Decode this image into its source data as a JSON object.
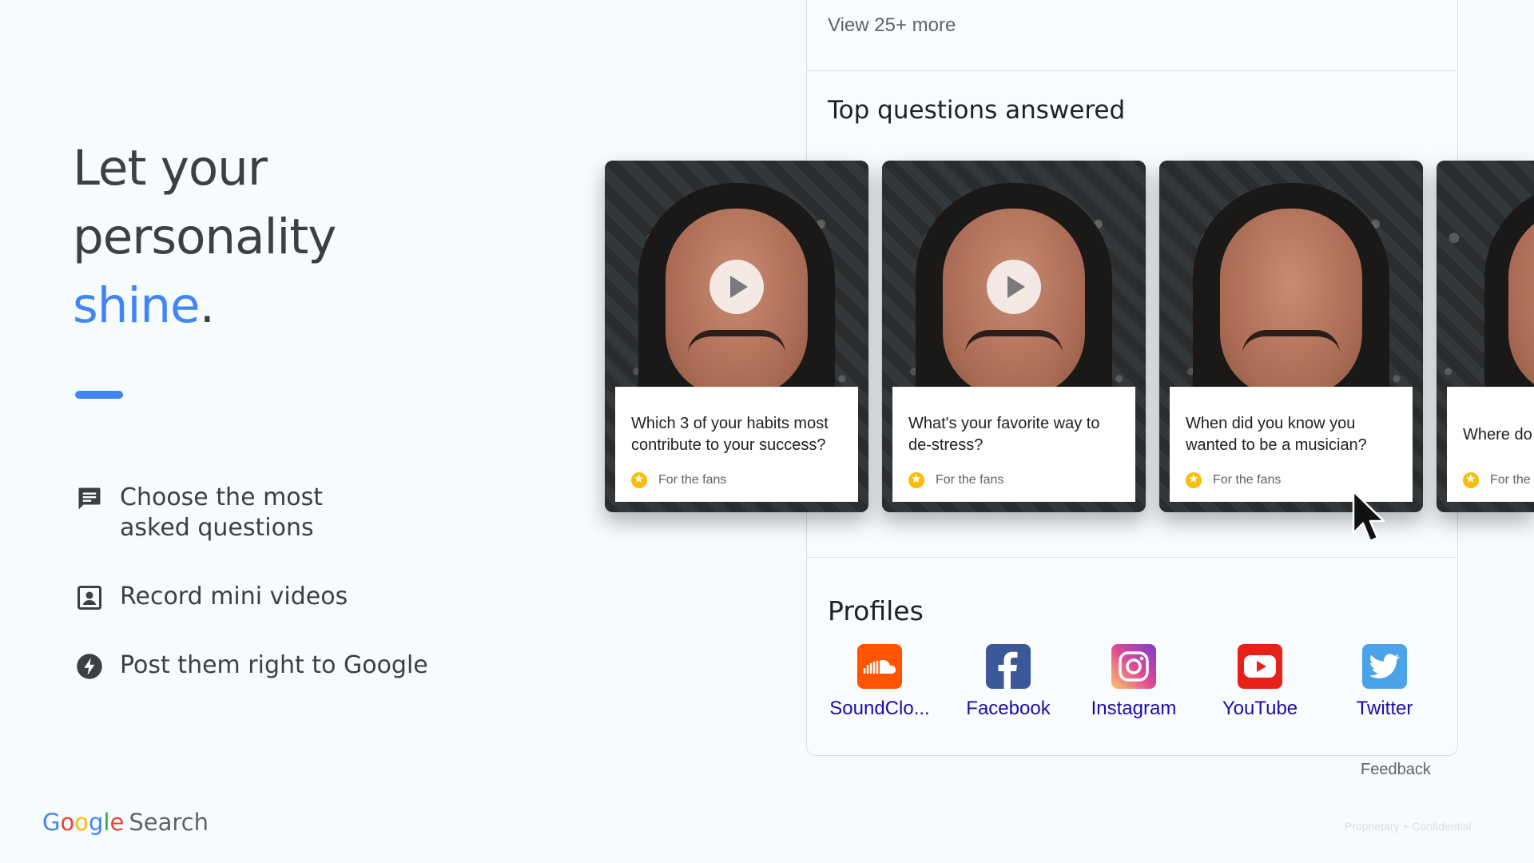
{
  "slide": {
    "headline_lines": [
      "Let your",
      "personality"
    ],
    "headline_accent": "shine",
    "headline_period": ".",
    "features": [
      {
        "icon": "chat-bubble-icon",
        "text": "Choose the most\nasked questions"
      },
      {
        "icon": "contact-frame-icon",
        "text": "Record mini videos"
      },
      {
        "icon": "bolt-icon",
        "text": "Post them right to Google"
      }
    ],
    "logo": {
      "g": "G",
      "o1": "o",
      "o2": "o",
      "g2": "g",
      "l": "l",
      "e": "e",
      "product": "Search"
    },
    "footer_note": "Proprietary + Confidential"
  },
  "panel": {
    "view_more": "View 25+ more",
    "questions_title": "Top questions answered",
    "cards": [
      {
        "question": "Which 3 of your habits most contribute to your success?",
        "badge": "For the fans",
        "has_play": true
      },
      {
        "question": "What's your favorite way to de-stress?",
        "badge": "For the fans",
        "has_play": true
      },
      {
        "question": "When did you know you wanted to be a musician?",
        "badge": "For the fans",
        "has_play": false
      },
      {
        "question": "Where do you find inspiration?",
        "badge": "For the fans",
        "has_play": false
      }
    ],
    "profiles_title": "Profiles",
    "profiles": [
      {
        "name": "SoundClo...",
        "icon": "soundcloud-icon",
        "color": "#ff5500"
      },
      {
        "name": "Facebook",
        "icon": "facebook-icon",
        "color": "#3b5998"
      },
      {
        "name": "Instagram",
        "icon": "instagram-icon",
        "color": "#c13584"
      },
      {
        "name": "YouTube",
        "icon": "youtube-icon",
        "color": "#ff0000"
      },
      {
        "name": "Twitter",
        "icon": "twitter-icon",
        "color": "#1da1f2"
      }
    ],
    "feedback": "Feedback"
  },
  "colors": {
    "accent": "#4285f4",
    "link": "#1a0dab",
    "badge": "#fbbc04"
  }
}
